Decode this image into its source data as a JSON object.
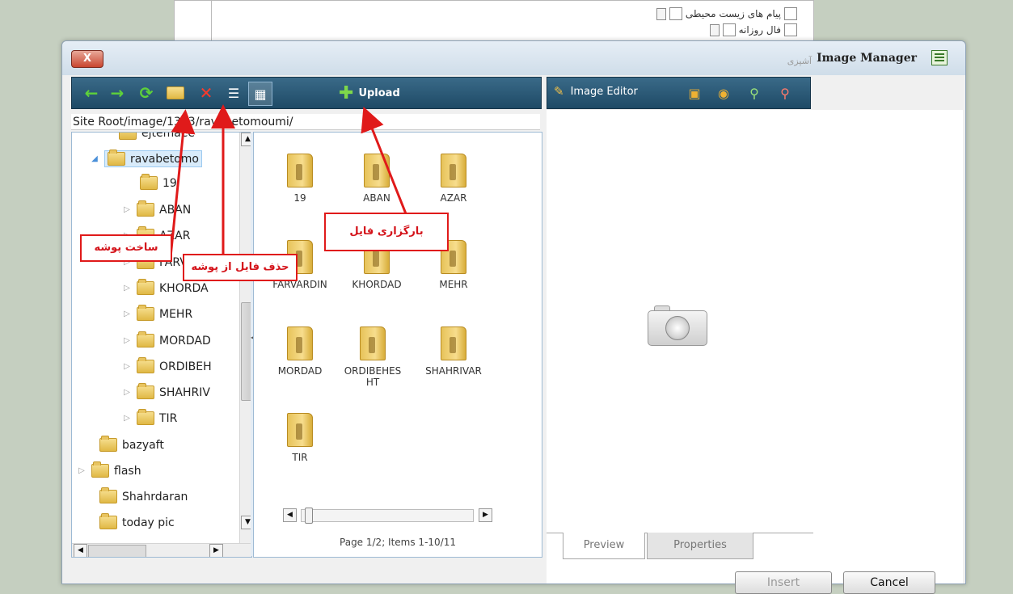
{
  "background": {
    "items": [
      {
        "label": "پیام های زیست محیطی"
      },
      {
        "label": "فال روزانه"
      },
      {
        "label": "آشپزی"
      }
    ]
  },
  "window": {
    "title": "Image Manager",
    "close_label": "X"
  },
  "toolbar": {
    "upload_label": "Upload",
    "buttons": [
      "back-icon",
      "forward-icon",
      "refresh-icon",
      "new-folder-icon",
      "delete-icon",
      "list-view-icon",
      "thumbnail-view-icon",
      "upload-icon"
    ]
  },
  "image_toolbar": {
    "editor_label": "Image Editor"
  },
  "path": "Site Root/image/1393/ravabetomoumi/",
  "tree": {
    "items": [
      {
        "label": "ejtemaee"
      },
      {
        "label": "ravabetomo"
      },
      {
        "label": "19"
      },
      {
        "label": "ABAN"
      },
      {
        "label": "AZAR"
      },
      {
        "label": "FARVARD"
      },
      {
        "label": "KHORDA"
      },
      {
        "label": "MEHR"
      },
      {
        "label": "MORDAD"
      },
      {
        "label": "ORDIBEH"
      },
      {
        "label": "SHAHRIV"
      },
      {
        "label": "TIR"
      },
      {
        "label": "bazyaft"
      },
      {
        "label": "flash"
      },
      {
        "label": "Shahrdaran"
      },
      {
        "label": "today pic"
      }
    ]
  },
  "files": {
    "items": [
      {
        "label": "19"
      },
      {
        "label": "ABAN"
      },
      {
        "label": "AZAR"
      },
      {
        "label": "FARVARDIN"
      },
      {
        "label": "KHORDAD"
      },
      {
        "label": "MEHR"
      },
      {
        "label": "MORDAD"
      },
      {
        "label": "ORDIBEHES HT"
      },
      {
        "label": "SHAHRIVAR"
      },
      {
        "label": "TIR"
      }
    ],
    "paging": "Page 1/2; Items 1-10/11"
  },
  "preview": {
    "tabs": [
      {
        "label": "Preview"
      },
      {
        "label": "Properties"
      }
    ],
    "insert_label": "Insert",
    "cancel_label": "Cancel"
  },
  "annotations": {
    "upload": "بارگزاری فایل",
    "new_folder": "ساخت پوشه",
    "delete": "حذف فایل از پوشه",
    "color": "#e01a1a"
  }
}
